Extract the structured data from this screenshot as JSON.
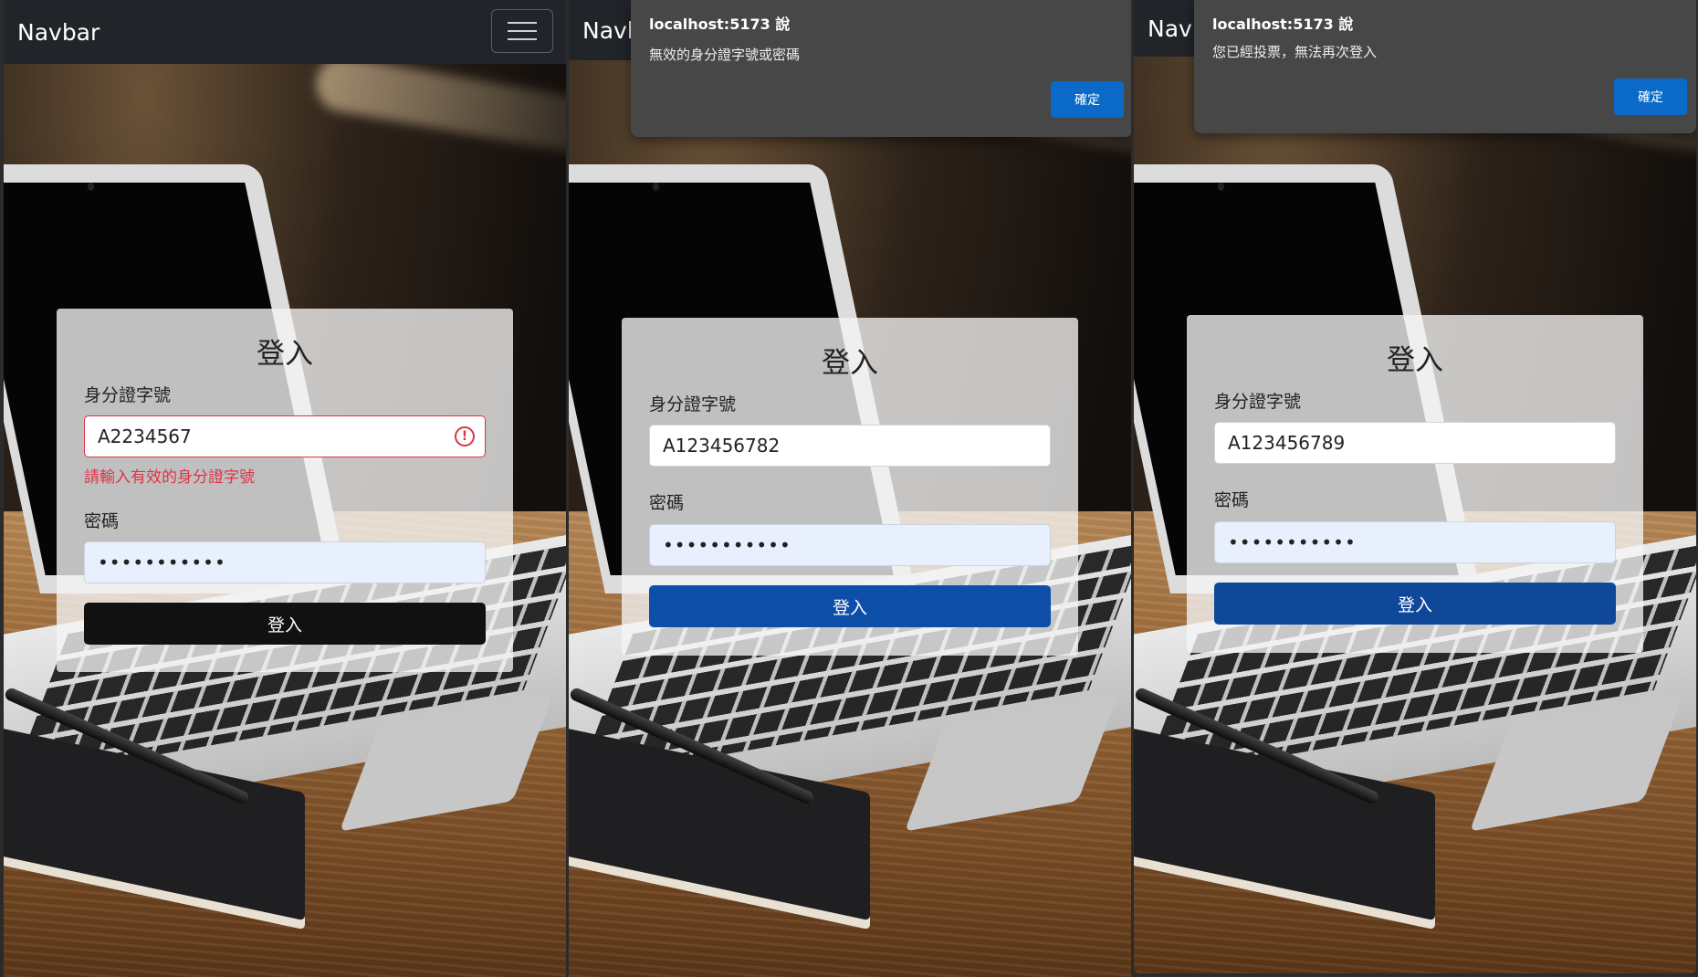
{
  "colors": {
    "navbar_bg": "#212529",
    "error": "#dc3545",
    "login_dark": "#111111",
    "login_blue": "#0d4fa8",
    "dialog_bg": "#474747",
    "dialog_button": "#0b6ac8"
  },
  "navbar": {
    "brand": "Navbar",
    "toggler_icon": "hamburger-menu-icon"
  },
  "panels": [
    {
      "card": {
        "title": "登入",
        "id_label": "身分證字號",
        "id_value": "A2234567",
        "id_error": "請輸入有效的身分證字號",
        "password_label": "密碼",
        "password_value": "password123",
        "login_button": "登入"
      }
    },
    {
      "dialog": {
        "title": "localhost:5173 說",
        "message": "無效的身分證字號或密碼",
        "ok_button": "確定"
      },
      "card": {
        "title": "登入",
        "id_label": "身分證字號",
        "id_value": "A123456782",
        "password_label": "密碼",
        "password_value": "password123",
        "login_button": "登入"
      }
    },
    {
      "dialog": {
        "title": "localhost:5173 說",
        "message": "您已經投票，無法再次登入",
        "ok_button": "確定"
      },
      "card": {
        "title": "登入",
        "id_label": "身分證字號",
        "id_value": "A123456789",
        "password_label": "密碼",
        "password_value": "password123",
        "login_button": "登入"
      }
    }
  ]
}
